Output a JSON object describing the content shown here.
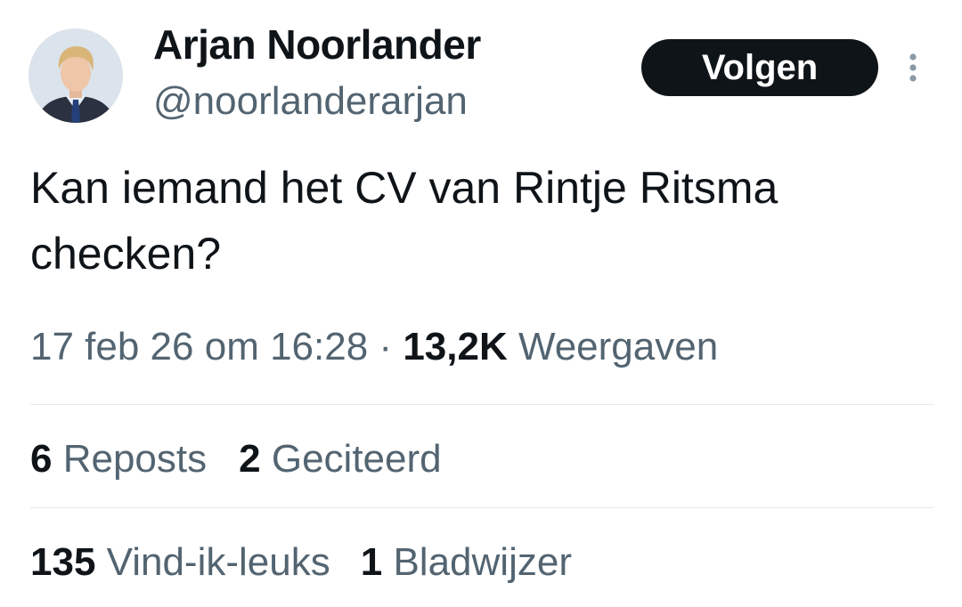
{
  "user": {
    "display_name": "Arjan Noorlander",
    "handle": "@noorlanderarjan",
    "avatar_icon": "profile-photo"
  },
  "follow_button": {
    "label": "Volgen"
  },
  "more_menu": {
    "icon": "more-vertical-icon"
  },
  "tweet": {
    "text": "Kan iemand het CV van Rintje Ritsma checken?"
  },
  "meta": {
    "timestamp": "17 feb 26 om 16:28",
    "separator": "·",
    "views_count": "13,2K",
    "views_label": "Weergaven"
  },
  "stats": {
    "reposts_count": "6",
    "reposts_label": "Reposts",
    "quotes_count": "2",
    "quotes_label": "Geciteerd",
    "likes_count": "135",
    "likes_label": "Vind-ik-leuks",
    "bookmarks_count": "1",
    "bookmarks_label": "Bladwijzer"
  },
  "colors": {
    "text_primary": "#0f1419",
    "text_secondary": "#536471",
    "button_bg": "#0f1419",
    "divider": "#e6e9ec"
  }
}
